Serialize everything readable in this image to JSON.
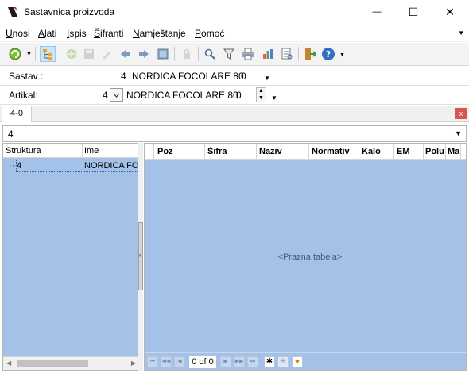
{
  "window": {
    "title": "Sastavnica proizvoda",
    "minimize_glyph": "—",
    "maximize_glyph": "☐",
    "close_glyph": "✕"
  },
  "menu": {
    "items": [
      {
        "underline": "U",
        "rest": "nosi"
      },
      {
        "underline": "A",
        "rest": "lati"
      },
      {
        "underline": "I",
        "rest": "spis"
      },
      {
        "underline": "Š",
        "rest": "ifranti"
      },
      {
        "underline": "N",
        "rest": "amještanje"
      },
      {
        "underline": "P",
        "rest": "omoć"
      }
    ]
  },
  "toolbar": {
    "icons": [
      "refresh-icon",
      "tree-view-icon",
      "add-icon",
      "save-icon",
      "edit-icon",
      "back-icon",
      "forward-icon",
      "image-icon",
      "lock-icon",
      "search-icon",
      "filter-icon",
      "print-icon",
      "chart-icon",
      "report-icon",
      "exit-icon",
      "help-icon"
    ]
  },
  "sastav": {
    "label": "Sastav :",
    "code": "4",
    "name": "NORDICA FOCOLARE 80",
    "version": "0"
  },
  "artikal": {
    "label": "Artikal:",
    "code": "4",
    "name": "NORDICA FOCOLARE 80",
    "version": "0"
  },
  "tabs": [
    {
      "label": "4-0"
    }
  ],
  "tab_close": "x",
  "filter": {
    "value": "4"
  },
  "tree": {
    "columns": [
      "Struktura",
      "Ime"
    ],
    "rows": [
      {
        "struktura": "4",
        "ime": "NORDICA FOC"
      }
    ]
  },
  "grid": {
    "columns": [
      "Poz",
      "Šifra",
      "Naziv",
      "Normativ",
      "Kalo",
      "EM",
      "Polu",
      "Ma"
    ],
    "empty_text": "<Prazna tabela>",
    "record_count": "0 of 0"
  },
  "colors": {
    "grid_background": "#a4c2e8",
    "tab_close": "#d9534f"
  }
}
